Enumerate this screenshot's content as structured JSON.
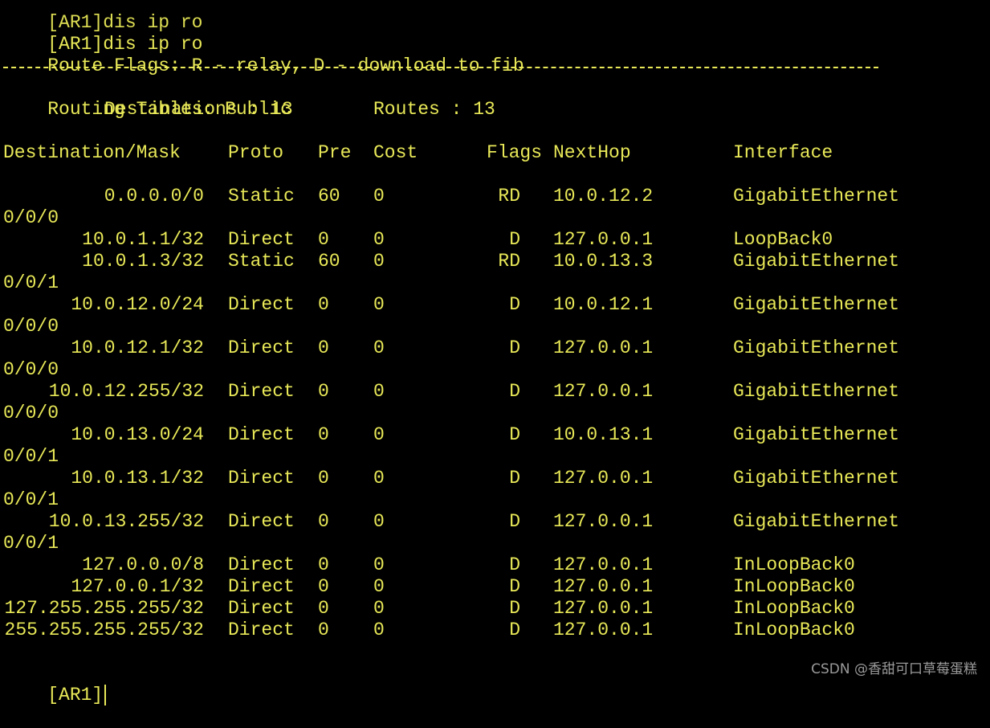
{
  "colors": {
    "background": "#000000",
    "text": "#e8e858",
    "watermark": "#9a9a9a"
  },
  "partial_top_line": "[AR1]dis ip ro",
  "command_line": "[AR1]dis ip ro",
  "flags_legend": "Route Flags: R - relay, D - download to fib",
  "separator": "------------------------------------------------------------------------------",
  "table_title": "Routing Tables: Public",
  "summary": {
    "destinations_label": "Destinations : 13",
    "routes_label": "Routes : 13"
  },
  "headers": {
    "destination": "Destination/Mask",
    "proto": "Proto",
    "pre": "Pre",
    "cost": "Cost",
    "flags": "Flags",
    "nexthop": "NextHop",
    "interface": "Interface"
  },
  "routes": [
    {
      "dest": "0.0.0.0/0",
      "proto": "Static",
      "pre": "60",
      "cost": "0",
      "flags": "RD",
      "nexthop": "10.0.12.2",
      "iface": "GigabitEthernet",
      "iface_cont": "0/0/0"
    },
    {
      "dest": "10.0.1.1/32",
      "proto": "Direct",
      "pre": "0",
      "cost": "0",
      "flags": "D",
      "nexthop": "127.0.0.1",
      "iface": "LoopBack0",
      "iface_cont": ""
    },
    {
      "dest": "10.0.1.3/32",
      "proto": "Static",
      "pre": "60",
      "cost": "0",
      "flags": "RD",
      "nexthop": "10.0.13.3",
      "iface": "GigabitEthernet",
      "iface_cont": "0/0/1"
    },
    {
      "dest": "10.0.12.0/24",
      "proto": "Direct",
      "pre": "0",
      "cost": "0",
      "flags": "D",
      "nexthop": "10.0.12.1",
      "iface": "GigabitEthernet",
      "iface_cont": "0/0/0"
    },
    {
      "dest": "10.0.12.1/32",
      "proto": "Direct",
      "pre": "0",
      "cost": "0",
      "flags": "D",
      "nexthop": "127.0.0.1",
      "iface": "GigabitEthernet",
      "iface_cont": "0/0/0"
    },
    {
      "dest": "10.0.12.255/32",
      "proto": "Direct",
      "pre": "0",
      "cost": "0",
      "flags": "D",
      "nexthop": "127.0.0.1",
      "iface": "GigabitEthernet",
      "iface_cont": "0/0/0"
    },
    {
      "dest": "10.0.13.0/24",
      "proto": "Direct",
      "pre": "0",
      "cost": "0",
      "flags": "D",
      "nexthop": "10.0.13.1",
      "iface": "GigabitEthernet",
      "iface_cont": "0/0/1"
    },
    {
      "dest": "10.0.13.1/32",
      "proto": "Direct",
      "pre": "0",
      "cost": "0",
      "flags": "D",
      "nexthop": "127.0.0.1",
      "iface": "GigabitEthernet",
      "iface_cont": "0/0/1"
    },
    {
      "dest": "10.0.13.255/32",
      "proto": "Direct",
      "pre": "0",
      "cost": "0",
      "flags": "D",
      "nexthop": "127.0.0.1",
      "iface": "GigabitEthernet",
      "iface_cont": "0/0/1"
    },
    {
      "dest": "127.0.0.0/8",
      "proto": "Direct",
      "pre": "0",
      "cost": "0",
      "flags": "D",
      "nexthop": "127.0.0.1",
      "iface": "InLoopBack0",
      "iface_cont": ""
    },
    {
      "dest": "127.0.0.1/32",
      "proto": "Direct",
      "pre": "0",
      "cost": "0",
      "flags": "D",
      "nexthop": "127.0.0.1",
      "iface": "InLoopBack0",
      "iface_cont": ""
    },
    {
      "dest": "127.255.255.255/32",
      "proto": "Direct",
      "pre": "0",
      "cost": "0",
      "flags": "D",
      "nexthop": "127.0.0.1",
      "iface": "InLoopBack0",
      "iface_cont": ""
    },
    {
      "dest": "255.255.255.255/32",
      "proto": "Direct",
      "pre": "0",
      "cost": "0",
      "flags": "D",
      "nexthop": "127.0.0.1",
      "iface": "InLoopBack0",
      "iface_cont": ""
    }
  ],
  "prompt": "[AR1]",
  "watermark": "CSDN @香甜可口草莓蛋糕"
}
